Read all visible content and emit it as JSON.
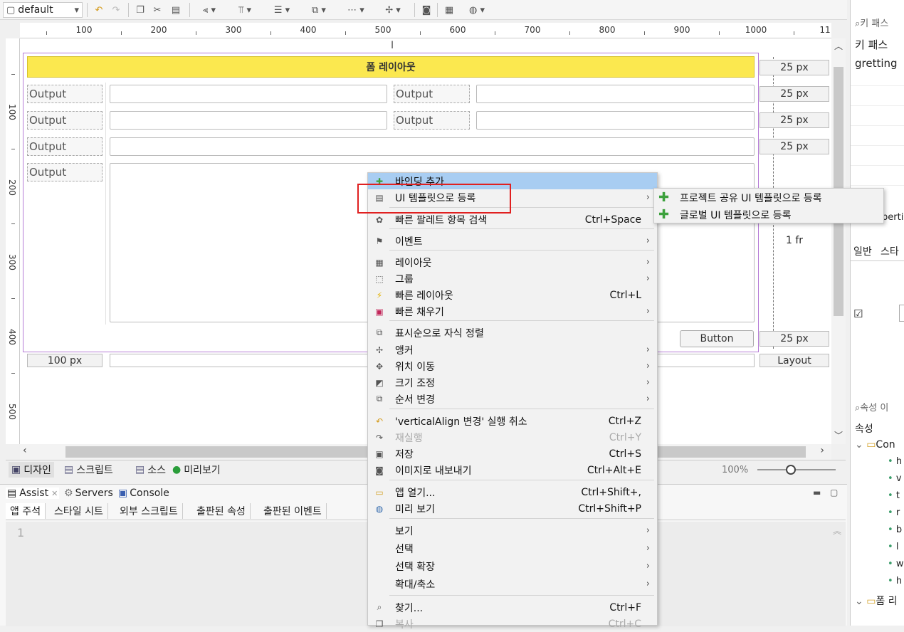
{
  "toolbar": {
    "layout_select": "default"
  },
  "ruler": {
    "h": [
      "100",
      "200",
      "300",
      "400",
      "500",
      "600",
      "700",
      "800",
      "900",
      "1000",
      "11"
    ],
    "v": [
      "100",
      "200",
      "300",
      "400",
      "500"
    ]
  },
  "form": {
    "title": "폼 레이아웃",
    "output_label": "Output",
    "row_heights": [
      "25 px",
      "25 px",
      "25 px",
      "1 fr",
      "25 px"
    ],
    "col_widths": [
      "100 px",
      "1 fr"
    ],
    "layout_label": "Layout",
    "button_label": "Button"
  },
  "bottom_tabs": [
    "디자인",
    "스크립트",
    "소스",
    "미리보기"
  ],
  "zoom": "100%",
  "panel_tabs": [
    "Assist",
    "Servers",
    "Console"
  ],
  "sub_tabs": [
    "앱 주석",
    "스타일 시트",
    "외부 스크립트",
    "출판된 속성",
    "출판된 이벤트"
  ],
  "editor_line": "1",
  "right_panel": {
    "search1": "키 패스",
    "header1": "키 패스",
    "value1": "gretting",
    "tab_properties": "pertie",
    "tab_general": "일반",
    "tab_style": "스타",
    "search2": "속성 이",
    "props_header": "속성",
    "tree1": "Con",
    "tree_items": [
      "h",
      "v",
      "t",
      "r",
      "b",
      "l",
      "w",
      "h"
    ],
    "tree2": "폼 리"
  },
  "context_menu": [
    {
      "label": "바인딩 추가",
      "shortcut": "",
      "arrow": false,
      "icon": "plus-icon"
    },
    {
      "label": "UI 템플릿으로 등록",
      "shortcut": "",
      "arrow": true,
      "icon": "template-icon"
    },
    {
      "label": "빠른 팔레트 항목 검색",
      "shortcut": "Ctrl+Space",
      "arrow": false,
      "icon": "palette-icon"
    },
    {
      "label": "이벤트",
      "shortcut": "",
      "arrow": true,
      "icon": "event-icon"
    },
    {
      "label": "레이아웃",
      "shortcut": "",
      "arrow": true,
      "icon": "layout-icon"
    },
    {
      "label": "그룹",
      "shortcut": "",
      "arrow": true,
      "icon": "group-icon"
    },
    {
      "label": "빠른 레이아웃",
      "shortcut": "Ctrl+L",
      "arrow": false,
      "icon": "lightning-icon"
    },
    {
      "label": "빠른 채우기",
      "shortcut": "",
      "arrow": true,
      "icon": "fill-icon"
    },
    {
      "label": "표시순으로 자식 정렬",
      "shortcut": "",
      "arrow": false,
      "icon": "sort-icon"
    },
    {
      "label": "앵커",
      "shortcut": "",
      "arrow": true,
      "icon": "anchor-icon"
    },
    {
      "label": "위치 이동",
      "shortcut": "",
      "arrow": true,
      "icon": "move-icon"
    },
    {
      "label": "크기 조정",
      "shortcut": "",
      "arrow": true,
      "icon": "resize-icon"
    },
    {
      "label": "순서 변경",
      "shortcut": "",
      "arrow": true,
      "icon": "order-icon"
    },
    {
      "label": "'verticalAlign 변경' 실행 취소",
      "shortcut": "Ctrl+Z",
      "arrow": false,
      "icon": "undo-icon"
    },
    {
      "label": "재실행",
      "shortcut": "Ctrl+Y",
      "arrow": false,
      "icon": "redo-icon",
      "disabled": true
    },
    {
      "label": "저장",
      "shortcut": "Ctrl+S",
      "arrow": false,
      "icon": "save-icon"
    },
    {
      "label": "이미지로 내보내기",
      "shortcut": "Ctrl+Alt+E",
      "arrow": false,
      "icon": "camera-icon"
    },
    {
      "label": "앱 열기...",
      "shortcut": "Ctrl+Shift+,",
      "arrow": false,
      "icon": "folder-icon"
    },
    {
      "label": "미리 보기",
      "shortcut": "Ctrl+Shift+P",
      "arrow": false,
      "icon": "globe-icon"
    },
    {
      "label": "보기",
      "shortcut": "",
      "arrow": true,
      "icon": ""
    },
    {
      "label": "선택",
      "shortcut": "",
      "arrow": true,
      "icon": ""
    },
    {
      "label": "선택 확장",
      "shortcut": "",
      "arrow": true,
      "icon": ""
    },
    {
      "label": "확대/축소",
      "shortcut": "",
      "arrow": true,
      "icon": ""
    },
    {
      "label": "찾기...",
      "shortcut": "Ctrl+F",
      "arrow": false,
      "icon": "search-icon"
    },
    {
      "label": "복사",
      "shortcut": "Ctrl+C",
      "arrow": false,
      "icon": "copy-icon",
      "disabled": true
    }
  ],
  "submenu": [
    "프로젝트 공유 UI 템플릿으로 등록",
    "글로벌 UI 템플릿으로 등록"
  ],
  "colors": {
    "banner": "#fbe84f",
    "selection": "#b57bd6",
    "highlight": "#e02020",
    "menu_hover": "#a8cdf2",
    "accent_plus": "#3da13d"
  }
}
